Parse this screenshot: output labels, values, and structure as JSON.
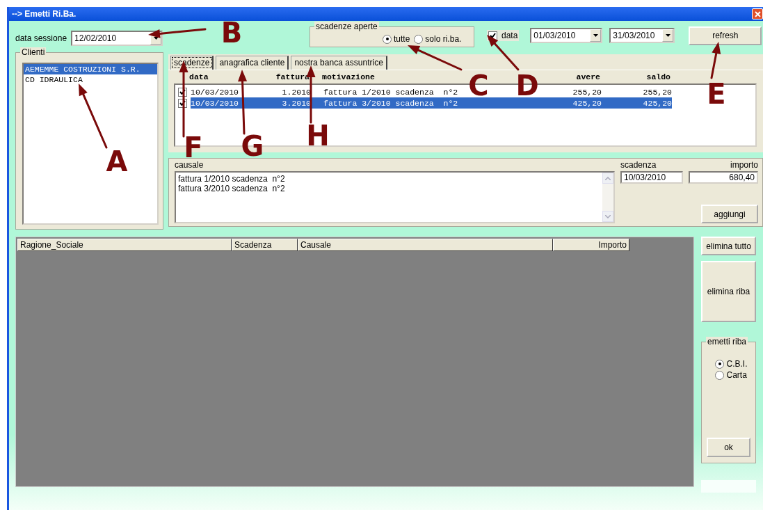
{
  "window": {
    "title": "--> Emetti Ri.Ba."
  },
  "session": {
    "label": "data sessione",
    "value": "12/02/2010"
  },
  "clients": {
    "title": "Clienti",
    "items": [
      {
        "name": "AEMEMME COSTRUZIONI S.R.",
        "selected": true
      },
      {
        "name": "CD IDRAULICA",
        "selected": false
      }
    ]
  },
  "open_due": {
    "title": "scadenze aperte",
    "options": [
      {
        "label": "tutte",
        "selected": true
      },
      {
        "label": "solo ri.ba.",
        "selected": false
      }
    ]
  },
  "date_filter": {
    "label": "data",
    "checked": true,
    "from": "01/03/2010",
    "to": "31/03/2010"
  },
  "refresh_button": "refresh",
  "tabs": [
    {
      "label": "scadenze",
      "selected": true
    },
    {
      "label": "anagrafica cliente",
      "selected": false
    },
    {
      "label": "nostra banca assuntrice",
      "selected": false
    }
  ],
  "due_table": {
    "columns": [
      "data",
      "fattura",
      "motivazione",
      "avere",
      "saldo"
    ],
    "rows": [
      {
        "checked": true,
        "selected": false,
        "data": "10/03/2010",
        "fattura": "1.2010",
        "motivazione": "fattura 1/2010 scadenza  n°2",
        "avere": "255,20",
        "saldo": "255,20"
      },
      {
        "checked": true,
        "selected": true,
        "data": "10/03/2010",
        "fattura": "3.2010",
        "motivazione": "fattura 3/2010 scadenza  n°2",
        "avere": "425,20",
        "saldo": "425,20"
      }
    ]
  },
  "causale": {
    "label": "causale",
    "lines": [
      "fattura 1/2010 scadenza  n°2",
      "fattura 3/2010 scadenza  n°2"
    ]
  },
  "scadenza": {
    "label": "scadenza",
    "value": "10/03/2010"
  },
  "importo": {
    "label": "importo",
    "value": "680,40"
  },
  "add_button": "aggiungi",
  "riba_table": {
    "columns": [
      "Ragione_Sociale",
      "Scadenza",
      "Causale",
      "Importo"
    ]
  },
  "buttons": [
    "elimina tutto",
    "elimina riba"
  ],
  "emit": {
    "title": "emetti riba",
    "options": [
      {
        "label": "C.B.I.",
        "selected": true
      },
      {
        "label": "Carta",
        "selected": false
      }
    ],
    "ok": "ok"
  },
  "annotations": [
    {
      "letter": "A"
    },
    {
      "letter": "B"
    },
    {
      "letter": "C"
    },
    {
      "letter": "D"
    },
    {
      "letter": "E"
    },
    {
      "letter": "F"
    },
    {
      "letter": "G"
    },
    {
      "letter": "H"
    }
  ]
}
